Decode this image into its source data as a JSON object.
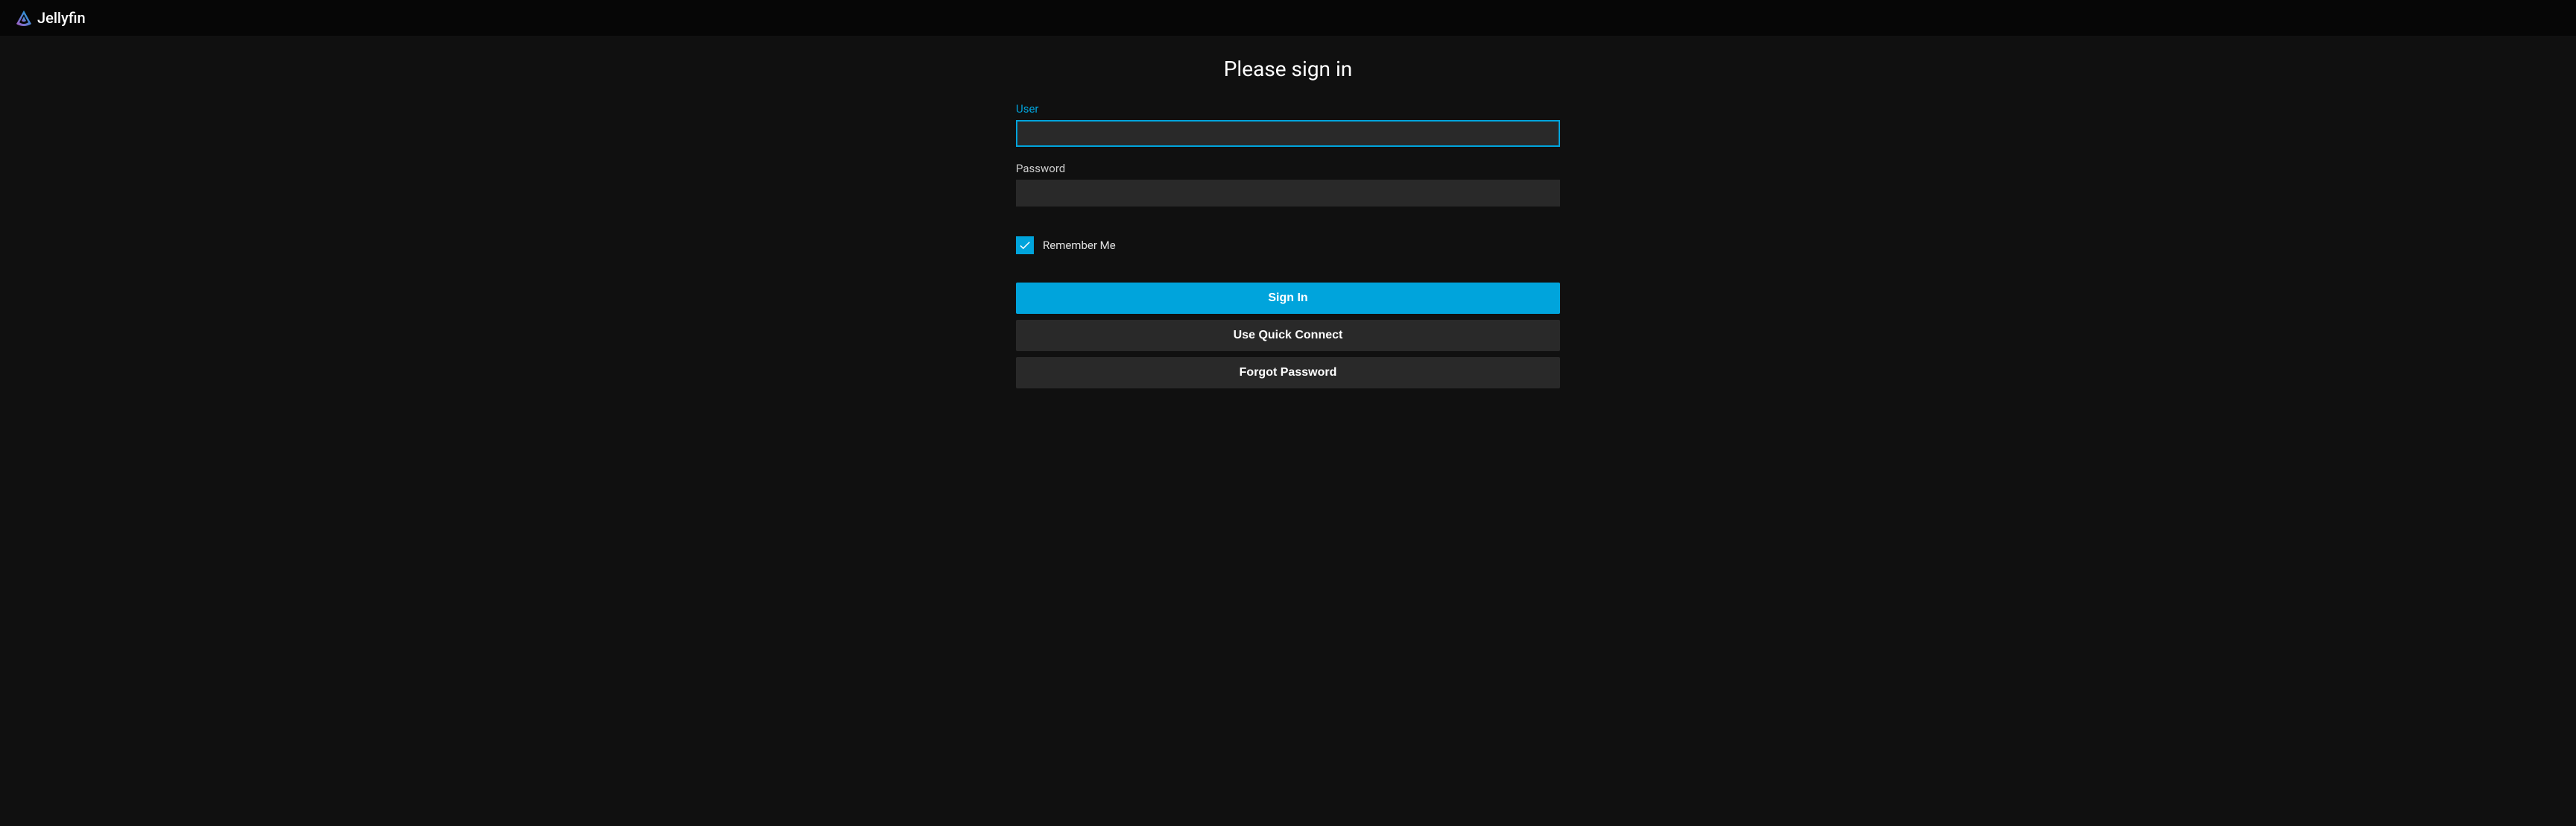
{
  "brand": {
    "name": "Jellyfin"
  },
  "page": {
    "title": "Please sign in"
  },
  "form": {
    "user": {
      "label": "User",
      "value": ""
    },
    "password": {
      "label": "Password",
      "value": ""
    },
    "remember": {
      "label": "Remember Me",
      "checked": true
    },
    "buttons": {
      "signin": "Sign In",
      "quickconnect": "Use Quick Connect",
      "forgot": "Forgot Password"
    }
  },
  "colors": {
    "accent": "#00a4dc",
    "background": "#101010",
    "header_bg": "#060606",
    "input_bg": "#292929"
  }
}
